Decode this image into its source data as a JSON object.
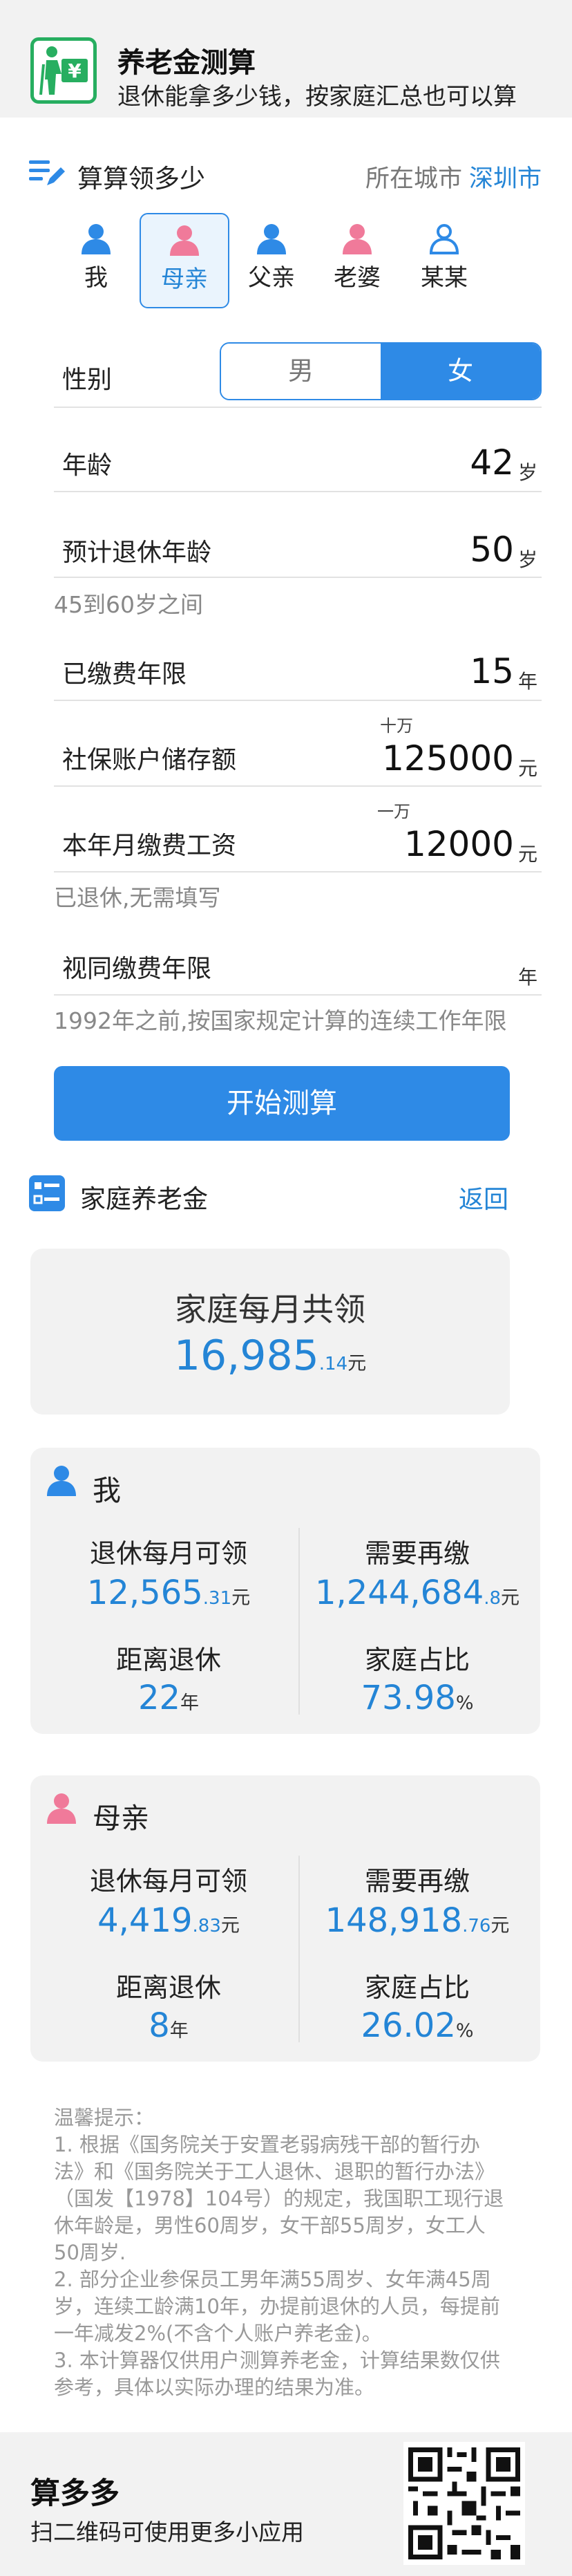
{
  "app": {
    "title": "养老金测算",
    "subtitle": "退休能拿多少钱，按家庭汇总也可以算"
  },
  "calc": {
    "title": "算算领多少",
    "city_label": "所在城市",
    "city": "深圳市"
  },
  "people": [
    {
      "label": "我",
      "icon": "person-icon",
      "color": "#2e8ae6"
    },
    {
      "label": "母亲",
      "icon": "person-icon",
      "color": "#f07a9a"
    },
    {
      "label": "父亲",
      "icon": "person-icon",
      "color": "#2e8ae6"
    },
    {
      "label": "老婆",
      "icon": "person-icon",
      "color": "#f07a9a"
    },
    {
      "label": "某某",
      "icon": "person-outline-icon",
      "color": "#2e8ae6"
    }
  ],
  "selected_person": "母亲",
  "form": {
    "gender_label": "性别",
    "gender_male": "男",
    "gender_female": "女",
    "gender_selected": "女",
    "age_label": "年龄",
    "age_value": "42",
    "age_unit": "岁",
    "retire_age_label": "预计退休年龄",
    "retire_age_value": "50",
    "retire_age_unit": "岁",
    "retire_age_hint": "45到60岁之间",
    "paid_years_label": "已缴费年限",
    "paid_years_value": "15",
    "paid_years_unit": "年",
    "account_label": "社保账户储存额",
    "account_scale": "十万",
    "account_value": "125000",
    "account_unit": "元",
    "wage_label": "本年月缴费工资",
    "wage_scale": "一万",
    "wage_value": "12000",
    "wage_unit": "元",
    "wage_hint": "已退休,无需填写",
    "deemed_label": "视同缴费年限",
    "deemed_value": "",
    "deemed_unit": "年",
    "deemed_hint": "1992年之前,按国家规定计算的连续工作年限",
    "start_button": "开始测算"
  },
  "family": {
    "title": "家庭养老金",
    "back": "返回",
    "total_label": "家庭每月共领",
    "total_int": "16,985",
    "total_dec": ".14",
    "total_unit": "元"
  },
  "members": [
    {
      "name": "我",
      "icon_color": "#2e8ae6",
      "monthly_label": "退休每月可领",
      "monthly_int": "12,565",
      "monthly_dec": ".31",
      "monthly_unit": "元",
      "topup_label": "需要再缴",
      "topup_int": "1,244,684",
      "topup_dec": ".8",
      "topup_unit": "元",
      "years_label": "距离退休",
      "years_value": "22",
      "years_unit": "年",
      "share_label": "家庭占比",
      "share_value": "73.98",
      "share_unit": "%"
    },
    {
      "name": "母亲",
      "icon_color": "#f07a9a",
      "monthly_label": "退休每月可领",
      "monthly_int": "4,419",
      "monthly_dec": ".83",
      "monthly_unit": "元",
      "topup_label": "需要再缴",
      "topup_int": "148,918",
      "topup_dec": ".76",
      "topup_unit": "元",
      "years_label": "距离退休",
      "years_value": "8",
      "years_unit": "年",
      "share_label": "家庭占比",
      "share_value": "26.02",
      "share_unit": "%"
    }
  ],
  "notes": [
    "温馨提示：",
    "1. 根据《国务院关于安置老弱病残干部的暂行办",
    "法》和《国务院关于工人退休、退职的暂行办法》",
    "（国发【1978】104号）的规定，我国职工现行退",
    "休年龄是，男性60周岁，女干部55周岁，女工人",
    "50周岁.",
    "2. 部分企业参保员工男年满55周岁、女年满45周",
    "岁，连续工龄满10年，办提前退休的人员，每提前",
    "一年减发2%(不含个人账户养老金)。",
    "3. 本计算器仅供用户测算养老金，计算结果数仅供",
    "参考，具体以实际办理的结果为准。"
  ],
  "footer": {
    "title": "算多多",
    "subtitle": "扫二维码可使用更多小应用"
  },
  "colors": {
    "accent": "#2e8ae6",
    "link": "#2485d6",
    "brand_green": "#27ae60",
    "female": "#f07a9a"
  }
}
